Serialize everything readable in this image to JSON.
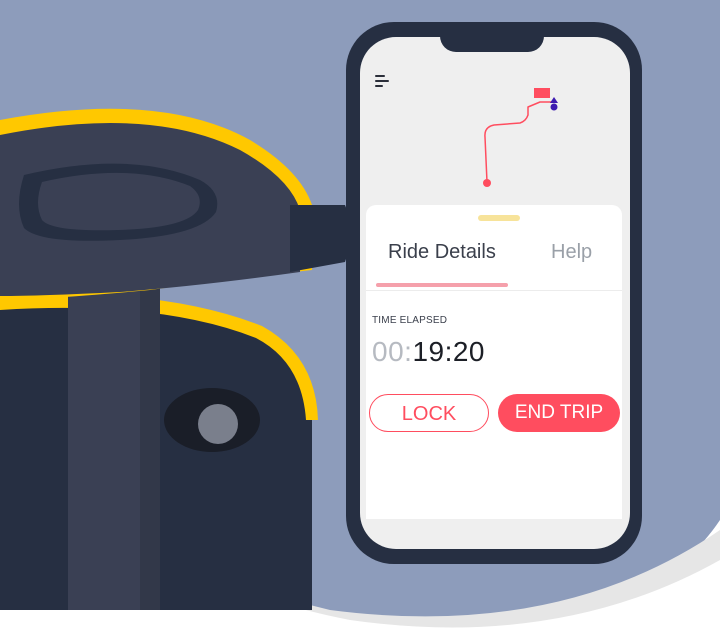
{
  "menu": {
    "icon": "hamburger-menu-icon"
  },
  "sheet": {
    "tabs": [
      {
        "label": "Ride Details",
        "active": true
      },
      {
        "label": "Help",
        "active": false
      }
    ],
    "time_elapsed_label": "TIME ELAPSED",
    "timer": {
      "hours": "00:",
      "minutes_seconds": "19:20"
    },
    "buttons": {
      "lock": "LOCK",
      "end_trip": "END TRIP"
    }
  },
  "colors": {
    "accent": "#ff4d5f",
    "background": "#8d9cbb",
    "scooter_yellow": "#ffc800",
    "scooter_dark": "#3a4054",
    "phone_frame": "#262f42",
    "route": "#ff4d5f",
    "current_location": "#3d1ab0"
  },
  "map": {
    "start_marker": "route-start-marker",
    "end_marker": "route-end-marker"
  }
}
